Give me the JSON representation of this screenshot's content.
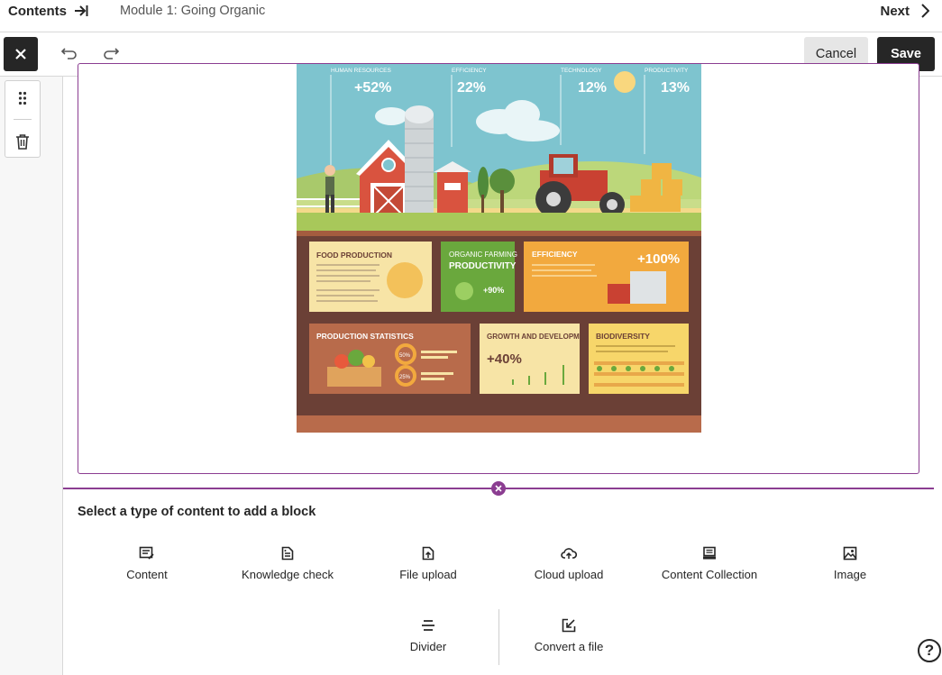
{
  "topnav": {
    "contents_label": "Contents",
    "module_title": "Module 1: Going Organic",
    "next_label": "Next"
  },
  "toolbar": {
    "cancel_label": "Cancel",
    "save_label": "Save"
  },
  "infographic": {
    "stats": [
      {
        "label": "HUMAN RESOURCES",
        "value": "+52%"
      },
      {
        "label": "EFFICIENCY",
        "value": "22%"
      },
      {
        "label": "TECHNOLOGY",
        "value": "12%"
      },
      {
        "label": "PRODUCTIVITY",
        "value": "13%"
      }
    ],
    "panels": {
      "food_production": "FOOD PRODUCTION",
      "organic_farming": "ORGANIC FARMING",
      "productivity": "PRODUCTIVITY",
      "productivity_value": "+90%",
      "efficiency": "EFFICIENCY",
      "efficiency_value": "+100%",
      "production_statistics": "PRODUCTION STATISTICS",
      "stat_a": "50%",
      "stat_b": "25%",
      "growth": "GROWTH AND DEVELOPMENT",
      "growth_value": "+40%",
      "biodiversity": "BIODIVERSITY"
    }
  },
  "add_block": {
    "title": "Select a type of content to add a block",
    "items": [
      {
        "label": "Content",
        "icon": "content-icon"
      },
      {
        "label": "Knowledge check",
        "icon": "knowledge-check-icon"
      },
      {
        "label": "File upload",
        "icon": "file-upload-icon"
      },
      {
        "label": "Cloud upload",
        "icon": "cloud-upload-icon"
      },
      {
        "label": "Content Collection",
        "icon": "content-collection-icon"
      },
      {
        "label": "Image",
        "icon": "image-icon"
      },
      {
        "label": "Divider",
        "icon": "divider-icon"
      },
      {
        "label": "Convert a file",
        "icon": "convert-file-icon"
      }
    ]
  },
  "help": {
    "label": "?"
  },
  "colors": {
    "accent": "#8b3d91",
    "dark_button": "#262626",
    "cancel_button": "#e6e6e6"
  }
}
